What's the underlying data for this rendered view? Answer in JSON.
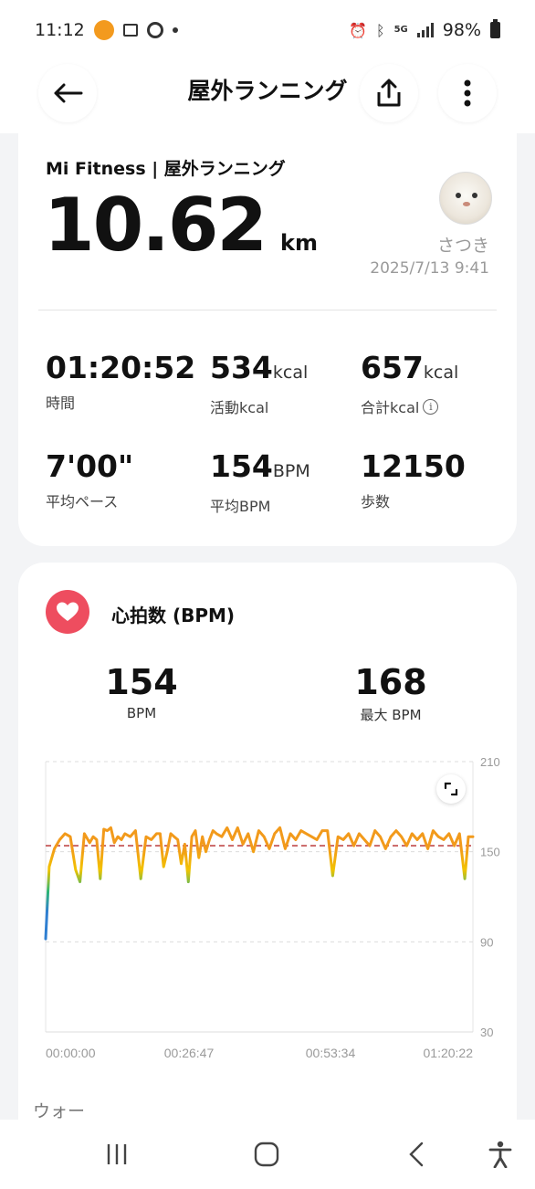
{
  "status_bar": {
    "time": "11:12",
    "network": "5G",
    "battery": "98%",
    "icons": [
      "app-notification-icon",
      "mail-icon",
      "sync-icon",
      "dot-icon",
      "alarm-icon",
      "bluetooth-icon",
      "5g-icon",
      "signal-icon",
      "battery-icon"
    ]
  },
  "header": {
    "title": "屋外ランニング",
    "back_icon": "arrow-left-icon",
    "share_icon": "share-icon",
    "more_icon": "more-vertical-icon"
  },
  "summary": {
    "source_label": "Mi Fitness | 屋外ランニング",
    "distance_value": "10.62",
    "distance_unit": "km",
    "user_name": "さつき",
    "date_time": "2025/7/13 9:41",
    "metrics": [
      {
        "value": "01:20:52",
        "unit": "",
        "label": "時間"
      },
      {
        "value": "534",
        "unit": "kcal",
        "label": "活動kcal"
      },
      {
        "value": "657",
        "unit": "kcal",
        "label": "合計kcal"
      },
      {
        "value": "7'00\"",
        "unit": "",
        "label": "平均ペース"
      },
      {
        "value": "154",
        "unit": "BPM",
        "label": "平均BPM"
      },
      {
        "value": "12150",
        "unit": "",
        "label": "歩数"
      }
    ]
  },
  "heart_rate": {
    "title": "心拍数 (BPM)",
    "average_value": "154",
    "average_label": "BPM",
    "max_value": "168",
    "max_label": "最大 BPM",
    "colors": {
      "badge": "#ee4d5f",
      "line_high": "#f29a1b",
      "line_mid": "#f2c300",
      "line_low": "#2bb673",
      "line_start": "#2f7fd1",
      "avg_line": "#c14a4a"
    }
  },
  "chart_data": {
    "type": "line",
    "title": "",
    "xlabel": "",
    "ylabel": "",
    "x_ticks": [
      "00:00:00",
      "00:26:47",
      "00:53:34",
      "01:20:22"
    ],
    "y_ticks": [
      210,
      150,
      90,
      30
    ],
    "ylim": [
      30,
      210
    ],
    "xlim_seconds": [
      0,
      4852
    ],
    "average_line": 154,
    "grid": true,
    "series": [
      {
        "x_seconds": [
          0,
          40,
          100,
          160,
          220,
          280,
          340,
          390,
          440,
          500,
          540,
          580,
          620,
          660,
          700,
          740,
          780,
          820,
          860,
          900,
          960,
          1020,
          1080,
          1140,
          1200,
          1260,
          1300,
          1340,
          1380,
          1420,
          1460,
          1500,
          1540,
          1580,
          1620,
          1660,
          1700,
          1740,
          1780,
          1820,
          1860,
          1900,
          1940,
          2000,
          2060,
          2120,
          2180,
          2240,
          2300,
          2360,
          2420,
          2480,
          2540,
          2600,
          2660,
          2720,
          2780,
          2840,
          2900,
          2960,
          3020,
          3080,
          3140,
          3200,
          3260,
          3320,
          3380,
          3440,
          3500,
          3560,
          3620,
          3680,
          3740,
          3800,
          3860,
          3920,
          3980,
          4040,
          4100,
          4160,
          4220,
          4280,
          4340,
          4400,
          4460,
          4520,
          4580,
          4640,
          4700,
          4760,
          4800,
          4852
        ],
        "y": [
          92,
          140,
          152,
          158,
          162,
          160,
          138,
          130,
          162,
          156,
          160,
          158,
          132,
          165,
          164,
          166,
          156,
          160,
          158,
          162,
          160,
          164,
          132,
          160,
          158,
          162,
          162,
          140,
          150,
          162,
          160,
          158,
          142,
          155,
          130,
          160,
          164,
          146,
          160,
          150,
          158,
          164,
          162,
          160,
          166,
          158,
          166,
          155,
          162,
          150,
          164,
          160,
          152,
          162,
          166,
          152,
          162,
          158,
          164,
          162,
          160,
          158,
          164,
          164,
          134,
          160,
          158,
          162,
          154,
          162,
          158,
          154,
          164,
          160,
          152,
          160,
          164,
          160,
          154,
          162,
          158,
          162,
          152,
          164,
          160,
          158,
          162,
          154,
          162,
          132,
          160,
          160
        ]
      }
    ]
  },
  "walk_label": "ウォー",
  "nav": {
    "icons": [
      "recent-apps-icon",
      "home-icon",
      "back-icon",
      "accessibility-icon"
    ]
  }
}
